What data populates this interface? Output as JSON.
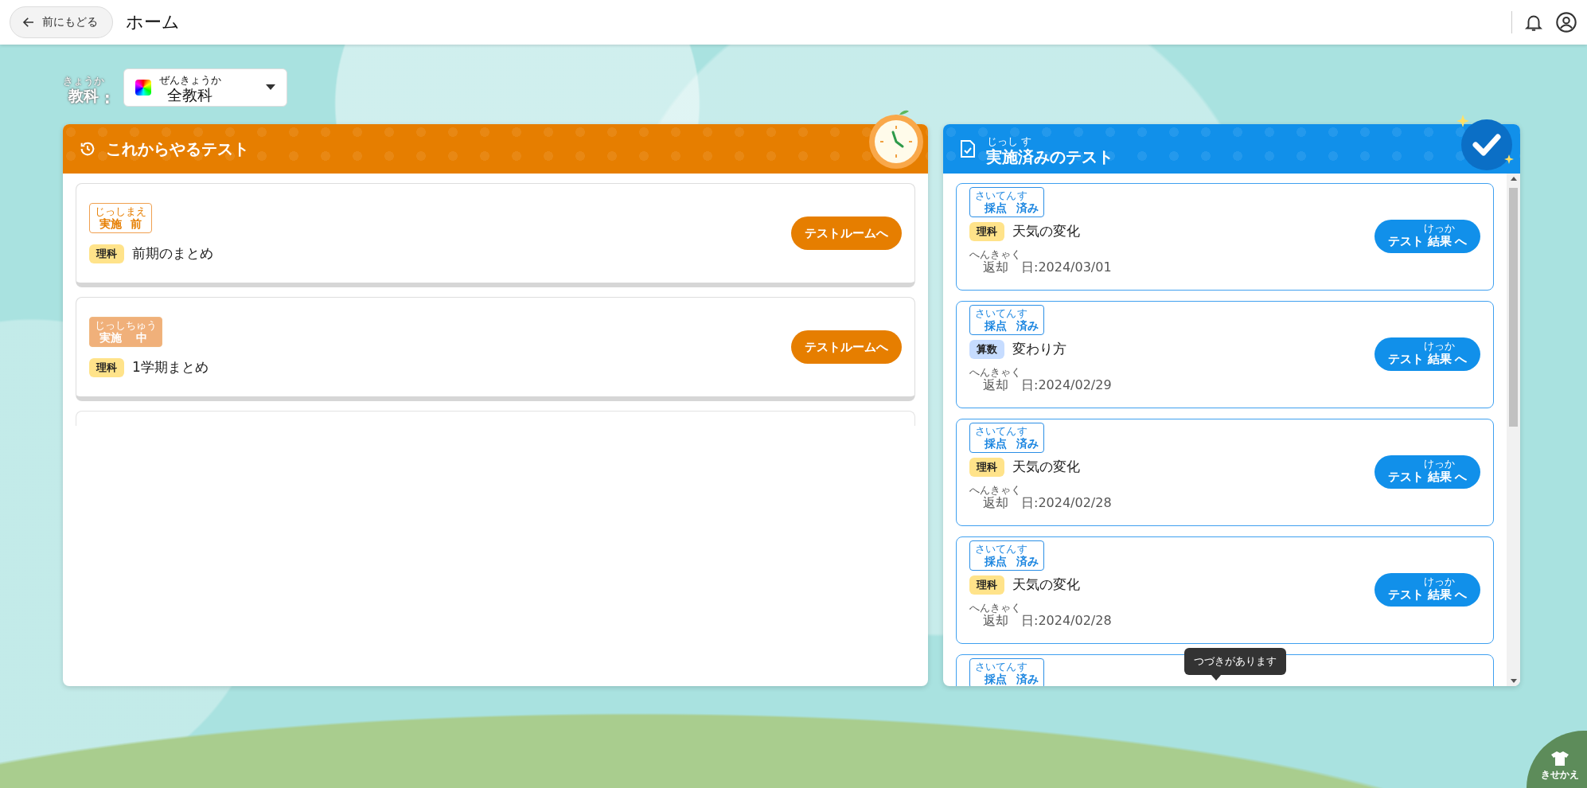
{
  "header": {
    "back_button": "前にもどる",
    "title": "ホーム"
  },
  "subject_filter": {
    "label": [
      {
        "text": "教科",
        "ruby": "きょうか"
      },
      {
        "text": ":"
      }
    ],
    "value": [
      {
        "text": "全教科",
        "ruby": "ぜんきょうか"
      }
    ]
  },
  "upcoming": {
    "title": [
      {
        "text": "これからやるテスト"
      }
    ],
    "tests": [
      {
        "status": {
          "kind": "before",
          "label": [
            {
              "text": "実施",
              "ruby": "じっし"
            },
            {
              "text": "前",
              "ruby": "まえ"
            }
          ]
        },
        "subject": {
          "label": "理科",
          "color": "#ffe38a"
        },
        "name": "前期のまとめ",
        "button": [
          {
            "text": "テストルームへ"
          }
        ]
      },
      {
        "status": {
          "kind": "during",
          "label": [
            {
              "text": "実施",
              "ruby": "じっし"
            },
            {
              "text": "中",
              "ruby": "ちゅう"
            }
          ]
        },
        "subject": {
          "label": "理科",
          "color": "#ffe38a"
        },
        "name": "1学期まとめ",
        "button": [
          {
            "text": "テストルームへ"
          }
        ]
      }
    ]
  },
  "completed": {
    "title": [
      {
        "text": "実施",
        "ruby": "じっし"
      },
      {
        "text": "済",
        "ruby": "す"
      },
      {
        "text": "みのテスト"
      }
    ],
    "tests": [
      {
        "status": {
          "kind": "graded",
          "label": [
            {
              "text": "採点",
              "ruby": "さいてん"
            },
            {
              "text": "済",
              "ruby": "す"
            },
            {
              "text": "み"
            }
          ]
        },
        "subject": {
          "label": "理科",
          "color": "#ffe38a"
        },
        "name": "天気の変化",
        "return_date": [
          {
            "text": "返却",
            "ruby": "へんきゃく"
          },
          {
            "text": "日:2024/03/01"
          }
        ],
        "button": [
          {
            "text": "テスト"
          },
          {
            "text": "結果",
            "ruby": "けっか"
          },
          {
            "text": "へ"
          }
        ]
      },
      {
        "status": {
          "kind": "graded",
          "label": [
            {
              "text": "採点",
              "ruby": "さいてん"
            },
            {
              "text": "済",
              "ruby": "す"
            },
            {
              "text": "み"
            }
          ]
        },
        "subject": {
          "label": "算数",
          "color": "#c6dcff"
        },
        "name": "変わり方",
        "return_date": [
          {
            "text": "返却",
            "ruby": "へんきゃく"
          },
          {
            "text": "日:2024/02/29"
          }
        ],
        "button": [
          {
            "text": "テスト"
          },
          {
            "text": "結果",
            "ruby": "けっか"
          },
          {
            "text": "へ"
          }
        ]
      },
      {
        "status": {
          "kind": "graded",
          "label": [
            {
              "text": "採点",
              "ruby": "さいてん"
            },
            {
              "text": "済",
              "ruby": "す"
            },
            {
              "text": "み"
            }
          ]
        },
        "subject": {
          "label": "理科",
          "color": "#ffe38a"
        },
        "name": "天気の変化",
        "return_date": [
          {
            "text": "返却",
            "ruby": "へんきゃく"
          },
          {
            "text": "日:2024/02/28"
          }
        ],
        "button": [
          {
            "text": "テスト"
          },
          {
            "text": "結果",
            "ruby": "けっか"
          },
          {
            "text": "へ"
          }
        ]
      },
      {
        "status": {
          "kind": "graded",
          "label": [
            {
              "text": "採点",
              "ruby": "さいてん"
            },
            {
              "text": "済",
              "ruby": "す"
            },
            {
              "text": "み"
            }
          ]
        },
        "subject": {
          "label": "理科",
          "color": "#ffe38a"
        },
        "name": "天気の変化",
        "return_date": [
          {
            "text": "返却",
            "ruby": "へんきゃく"
          },
          {
            "text": "日:2024/02/28"
          }
        ],
        "button": [
          {
            "text": "テスト"
          },
          {
            "text": "結果",
            "ruby": "けっか"
          },
          {
            "text": "へ"
          }
        ]
      },
      {
        "status": {
          "kind": "graded",
          "label": [
            {
              "text": "採点",
              "ruby": "さいてん"
            },
            {
              "text": "済",
              "ruby": "す"
            },
            {
              "text": "み"
            }
          ]
        }
      }
    ],
    "tooltip": "つづきがあります"
  },
  "dressup_button": "きせかえ"
}
